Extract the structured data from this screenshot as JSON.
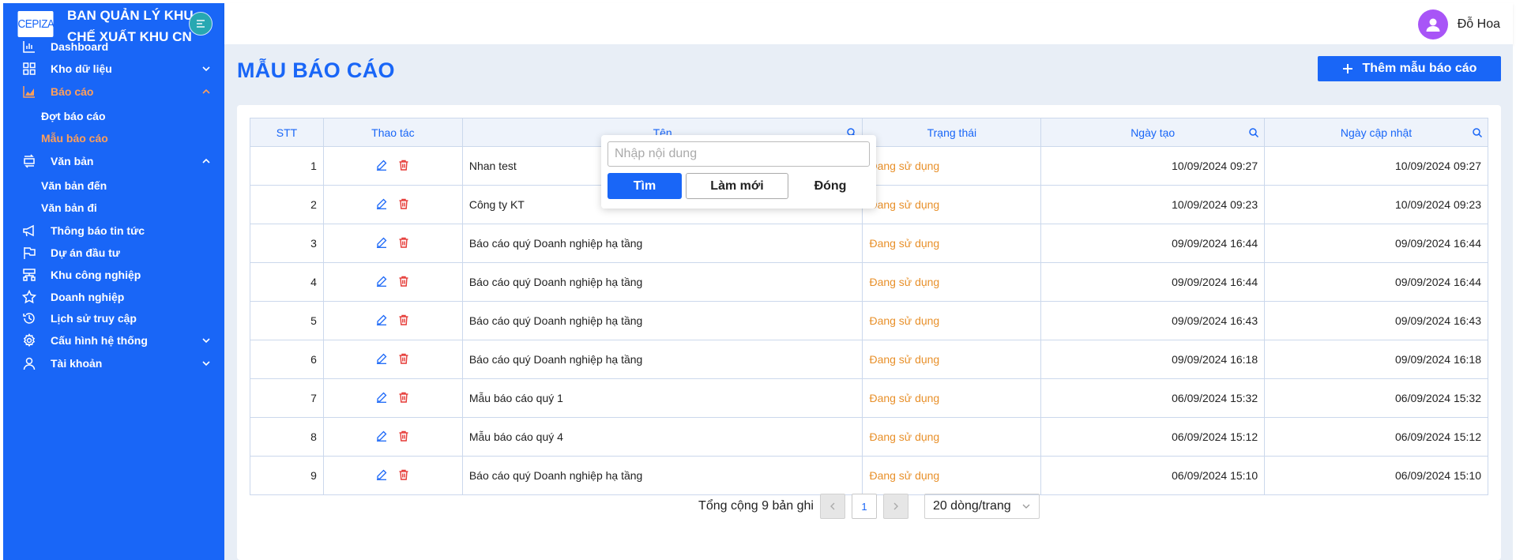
{
  "sidebar": {
    "logo_text": "CEPIZA",
    "brand_title": "BAN QUẢN LÝ KHU CHẾ XUẤT KHU CN",
    "items": {
      "dashboard": "Dashboard",
      "kho": "Kho dữ liệu",
      "baocao": "Báo cáo",
      "dot_bao_cao": "Đợt báo cáo",
      "mau_bao_cao": "Mẫu báo cáo",
      "vanban": "Văn bản",
      "vb_den": "Văn bản đến",
      "vb_di": "Văn bản đi",
      "thongbao": "Thông báo tin tức",
      "duan": "Dự án đầu tư",
      "khucn": "Khu công nghiệp",
      "doanhnghiep": "Doanh nghiệp",
      "lichsu": "Lịch sử truy cập",
      "cauhinh": "Cấu hình hệ thống",
      "taikhoan": "Tài khoản"
    },
    "active_color": "#ff9f5a",
    "bg_color": "#1966f7"
  },
  "header": {
    "user_name": "Đỗ Hoa"
  },
  "page": {
    "title": "MẪU BÁO CÁO",
    "add_button": "Thêm mẫu báo cáo"
  },
  "table": {
    "columns": [
      "STT",
      "Thao tác",
      "Tên",
      "Trạng thái",
      "Ngày tạo",
      "Ngày cập nhật"
    ],
    "rows": [
      {
        "stt": "1",
        "ten": "Nhan test",
        "trang_thai": "Đang sử dụng",
        "ngay_tao": "10/09/2024 09:27",
        "ngay_cap_nhat": "10/09/2024 09:27"
      },
      {
        "stt": "2",
        "ten": "Công ty KT",
        "trang_thai": "Đang sử dụng",
        "ngay_tao": "10/09/2024 09:23",
        "ngay_cap_nhat": "10/09/2024 09:23"
      },
      {
        "stt": "3",
        "ten": "Báo cáo quý Doanh nghiệp hạ tầng",
        "trang_thai": "Đang sử dụng",
        "ngay_tao": "09/09/2024 16:44",
        "ngay_cap_nhat": "09/09/2024 16:44"
      },
      {
        "stt": "4",
        "ten": "Báo cáo quý Doanh nghiệp hạ tầng",
        "trang_thai": "Đang sử dụng",
        "ngay_tao": "09/09/2024 16:44",
        "ngay_cap_nhat": "09/09/2024 16:44"
      },
      {
        "stt": "5",
        "ten": "Báo cáo quý Doanh nghiệp hạ tầng",
        "trang_thai": "Đang sử dụng",
        "ngay_tao": "09/09/2024 16:43",
        "ngay_cap_nhat": "09/09/2024 16:43"
      },
      {
        "stt": "6",
        "ten": "Báo cáo quý Doanh nghiệp hạ tầng",
        "trang_thai": "Đang sử dụng",
        "ngay_tao": "09/09/2024 16:18",
        "ngay_cap_nhat": "09/09/2024 16:18"
      },
      {
        "stt": "7",
        "ten": "Mẫu báo cáo quý 1",
        "trang_thai": "Đang sử dụng",
        "ngay_tao": "06/09/2024 15:32",
        "ngay_cap_nhat": "06/09/2024 15:32"
      },
      {
        "stt": "8",
        "ten": "Mẫu báo cáo quý 4",
        "trang_thai": "Đang sử dụng",
        "ngay_tao": "06/09/2024 15:12",
        "ngay_cap_nhat": "06/09/2024 15:12"
      },
      {
        "stt": "9",
        "ten": "Báo cáo quý Doanh nghiệp hạ tầng",
        "trang_thai": "Đang sử dụng",
        "ngay_tao": "06/09/2024 15:10",
        "ngay_cap_nhat": "06/09/2024 15:10"
      }
    ]
  },
  "search_popup": {
    "placeholder": "Nhập nội dung",
    "find_label": "Tìm",
    "reset_label": "Làm mới",
    "close_label": "Đóng"
  },
  "pagination": {
    "total_text": "Tổng cộng 9 bản ghi",
    "current_page": "1",
    "page_size_label": "20 dòng/trang"
  }
}
